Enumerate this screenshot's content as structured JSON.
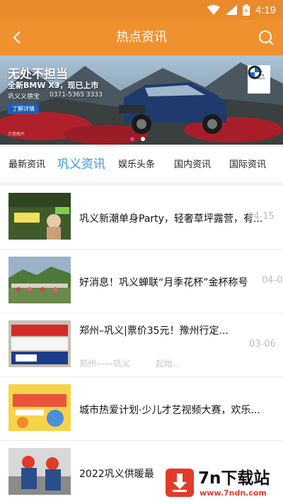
{
  "status_bar": {
    "time": "4:19"
  },
  "app_bar": {
    "title": "热点资讯"
  },
  "banner": {
    "headline": "无处不担当",
    "subline": "全新BMW X3，现已上市",
    "dealer": "巩义义德宝",
    "phone": "0371-5365 3333",
    "cta": "了解详情",
    "footnote": "示意图片"
  },
  "tabs": [
    {
      "label": "最新资讯"
    },
    {
      "label": "巩义资讯"
    },
    {
      "label": "娱乐头条"
    },
    {
      "label": "国内资讯"
    },
    {
      "label": "国际资讯"
    }
  ],
  "news": [
    {
      "title": "巩义新潮单身Party，轻奢草坪露营，有...",
      "date": "04-15"
    },
    {
      "title": "好消息！巩义蝉联“月季花杯”金杯称号",
      "date": "04-07"
    },
    {
      "title": "郑州–巩义|票价35元！豫州行定...",
      "date": "03-06",
      "meta_from": "郑州——巩义",
      "meta_text": "起始..."
    },
    {
      "title": "城市热爱计划·少儿才艺视频大赛，欢乐...",
      "date": ""
    },
    {
      "title": "2022巩义供暖最",
      "date": ""
    }
  ],
  "watermark": {
    "name": "7n下载站",
    "url": "www.7ndn.com"
  },
  "colors": {
    "brand_orange": "#f0912f",
    "tab_active": "#3a97d3"
  }
}
